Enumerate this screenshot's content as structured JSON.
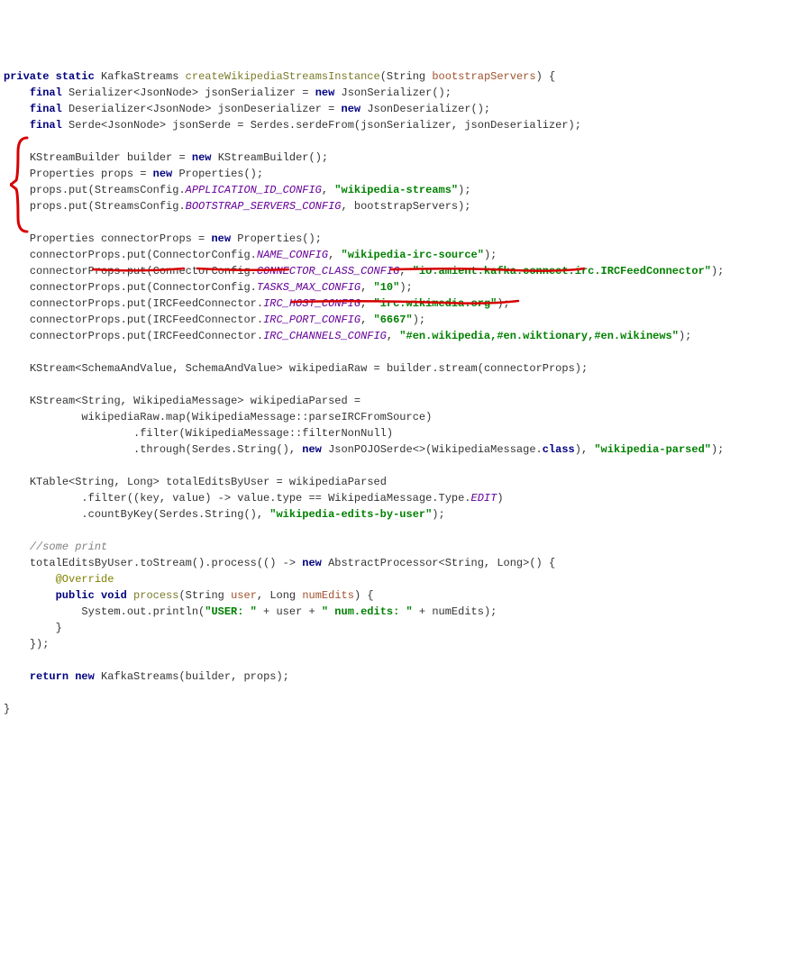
{
  "code": {
    "kw_private": "private",
    "kw_static": "static",
    "kw_final": "final",
    "kw_new": "new",
    "kw_return": "return",
    "kw_void": "void",
    "kw_public": "public",
    "type_KafkaStreams": "KafkaStreams",
    "method_name": "createWikipediaStreamsInstance",
    "type_String": "String",
    "param_bootstrapServers": "bootstrapServers",
    "type_Serializer": "Serializer",
    "type_JsonNode": "JsonNode",
    "var_jsonSerializer": "jsonSerializer",
    "type_JsonSerializer": "JsonSerializer",
    "type_Deserializer": "Deserializer",
    "var_jsonDeserializer": "jsonDeserializer",
    "type_JsonDeserializer": "JsonDeserializer",
    "type_Serde": "Serde",
    "var_jsonSerde": "jsonSerde",
    "Serdes_serdeFrom": "Serdes.serdeFrom",
    "type_KStreamBuilder": "KStreamBuilder",
    "var_builder": "builder",
    "type_Properties": "Properties",
    "var_props": "props",
    "props_put": "props.put",
    "StreamsConfig": "StreamsConfig",
    "APPLICATION_ID_CONFIG": "APPLICATION_ID_CONFIG",
    "str_wikipedia_streams": "\"wikipedia-streams\"",
    "BOOTSTRAP_SERVERS_CONFIG": "BOOTSTRAP_SERVERS_CONFIG",
    "var_connectorProps": "connectorProps",
    "connectorProps_put": "connectorProps.put",
    "ConnectorConfig": "ConnectorConfig",
    "NAME_CONFIG": "NAME_CONFIG",
    "str_wikipedia_irc_source": "\"wikipedia-irc-source\"",
    "CONNECTOR_CLASS_CONFIG": "CONNECTOR_CLASS_CONFIG",
    "str_irc_connector_class": "\"io.amient.kafka.connect.irc.IRCFeedConnector\"",
    "TASKS_MAX_CONFIG": "TASKS_MAX_CONFIG",
    "str_10": "\"10\"",
    "IRCFeedConnector": "IRCFeedConnector",
    "IRC_HOST_CONFIG": "IRC_HOST_CONFIG",
    "str_irc_host": "\"irc.wikimedia.org\"",
    "IRC_PORT_CONFIG": "IRC_PORT_CONFIG",
    "str_6667": "\"6667\"",
    "IRC_CHANNELS_CONFIG": "IRC_CHANNELS_CONFIG",
    "str_channels": "\"#en.wikipedia,#en.wiktionary,#en.wikinews\"",
    "type_KStream": "KStream",
    "type_SchemaAndValue": "SchemaAndValue",
    "var_wikipediaRaw": "wikipediaRaw",
    "builder_stream": "builder.stream",
    "type_WikipediaMessage": "WikipediaMessage",
    "var_wikipediaParsed": "wikipediaParsed",
    "wikipediaRaw_map": "wikipediaRaw.map",
    "WikipediaMessage_parseIRCFromSource": "parseIRCFromSource",
    "filter_nonnull": ".filter(WikipediaMessage::filterNonNull)",
    "through_call": ".through(Serdes.String(), ",
    "type_JsonPOJOSerde": "JsonPOJOSerde",
    "WikipediaMessage_class": "(WikipediaMessage.",
    "kw_class": "class",
    "str_wikipedia_parsed": "\"wikipedia-parsed\"",
    "type_KTable": "KTable",
    "type_Long": "Long",
    "var_totalEditsByUser": "totalEditsByUser",
    "filter_lambda_pre": ".filter((key, value) -> value.type == WikipediaMessage.Type.",
    "EDIT": "EDIT",
    "countByKey": ".countByKey(Serdes.String(), ",
    "str_wikipedia_edits_by_user": "\"wikipedia-edits-by-user\"",
    "comment_some_print": "//some print",
    "toStream_process": "totalEditsByUser.toStream().process(() -> ",
    "type_AbstractProcessor": "AbstractProcessor",
    "anno_Override": "@Override",
    "method_process": "process",
    "param_user": "user",
    "param_numEdits": "numEdits",
    "sysout_pre": "System.out.println(",
    "str_USER": "\"USER: \"",
    "str_num_edits": "\" num.edits: \"",
    "plus": " + ",
    "rbrace": "}",
    "rbrace_paren_semi": "});",
    "return_new": "return new",
    "KafkaStreams_call": "KafkaStreams(builder, props);"
  },
  "annotations": {
    "bracket_color": "#d60000",
    "underline_color": "#d60000"
  }
}
